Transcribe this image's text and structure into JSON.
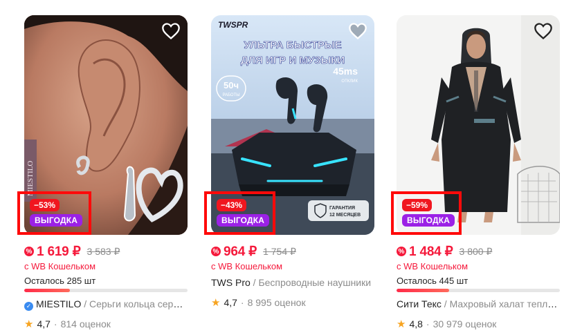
{
  "cards": [
    {
      "discount": "−53%",
      "promo": "ВЫГОДКА",
      "price": "1 619 ₽",
      "old_price": "3 583 ₽",
      "wallet": "с WB Кошельком",
      "stock": "Осталось 285 шт",
      "stock_level": 0.28,
      "brand": "MIESTILO",
      "name": "Серьги кольца серебряные",
      "rating": "4,7",
      "reviews": "814 оценок",
      "image_text": "MIESTILO"
    },
    {
      "discount": "−43%",
      "promo": "ВЫГОДКА",
      "price": "964 ₽",
      "old_price": "1 754 ₽",
      "wallet": "с WB Кошельком",
      "brand": "TWS Pro",
      "name": "Беспроводные наушники",
      "rating": "4,7",
      "reviews": "8 995 оценок",
      "image_text": {
        "logo": "TWSPR",
        "headline1": "УЛЬТРА БЫСТРЫЕ",
        "headline2": "ДЛЯ ИГР И МУЗЫКИ",
        "hours": "50ч",
        "hours_label": "РАБОТЫ",
        "latency": "45ms",
        "latency_label": "ОТКЛИК",
        "warranty1": "ГАРАНТИЯ",
        "warranty2": "12 МЕСЯЦЕВ"
      }
    },
    {
      "discount": "−59%",
      "promo": "ВЫГОДКА",
      "price": "1 484 ₽",
      "old_price": "3 800 ₽",
      "wallet": "с WB Кошельком",
      "stock": "Осталось 445 шт",
      "stock_level": 0.32,
      "brand": "Сити Текс",
      "name": "Махровый халат теплый",
      "rating": "4,8",
      "reviews": "30 979 оценок"
    }
  ],
  "separator": "/",
  "dot": "·",
  "currency_icon": "wb-wallet-icon",
  "colors": {
    "price": "#f5193b",
    "discount": "#f0161f",
    "promo": "#9b21e6",
    "highlight": "#ff0a0a"
  }
}
